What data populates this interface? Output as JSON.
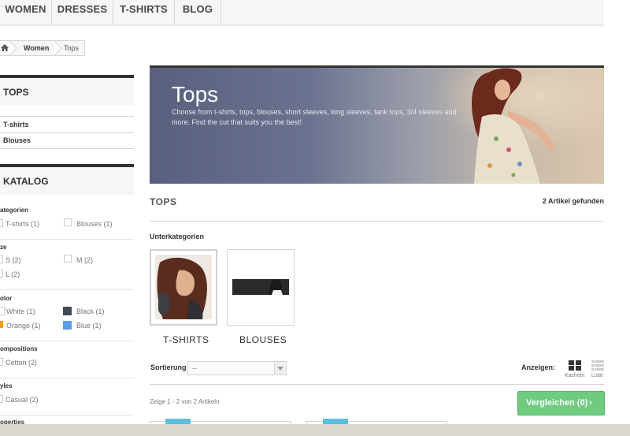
{
  "nav": {
    "items": [
      "WOMEN",
      "DRESSES",
      "T-SHIRTS",
      "BLOG"
    ]
  },
  "breadcrumb": {
    "items": [
      "Women",
      "Tops"
    ]
  },
  "sidebar": {
    "categories_block": {
      "title": "TOPS",
      "links": [
        "T-shirts",
        "Blouses"
      ]
    },
    "catalog_block": {
      "title": "KATALOG",
      "filters": [
        {
          "title": "ategorien",
          "options": [
            "T-shirts (1)",
            "Blouses (1)"
          ]
        },
        {
          "title": "ze",
          "options": [
            "S (2)",
            "M (2)",
            "L (2)"
          ]
        },
        {
          "title": "olor",
          "options": [
            "White (1)",
            "Black (1)",
            "Orange (1)",
            "Blue (1)"
          ]
        },
        {
          "title": "ompositions",
          "options": [
            "Cotton (2)"
          ]
        },
        {
          "title": "yles",
          "options": [
            "Casual (2)"
          ]
        },
        {
          "title": "operties",
          "options": []
        }
      ],
      "swatch_colors": {
        "white": "#ffffff",
        "black": "#434a54",
        "orange": "#f39c11",
        "blue": "#5d9cec"
      }
    }
  },
  "banner": {
    "title": "Tops",
    "description": "Choose from t-shirts, tops, blouses, short sleeves, long sleeves, tank tops, 3/4 sleeves and more. Find the cut that suits you the best!"
  },
  "content": {
    "heading": "TOPS",
    "found": "2 Artikel gefunden",
    "subcategories_label": "Unterkategorien",
    "subcategories": [
      "T-SHIRTS",
      "BLOUSES"
    ]
  },
  "toolbar": {
    "sort_label": "Sortierung",
    "sort_value": "--",
    "view_label": "Anzeigen:",
    "grid_label": "Kacheln",
    "list_label": "Liste",
    "showing": "Zeige 1 - 2 von 2 Artikeln",
    "compare_label": "Vergleichen (0)",
    "compare_chevron": "›"
  },
  "colors": {
    "accent_green": "#6ecb80",
    "dark_border": "#333333"
  }
}
